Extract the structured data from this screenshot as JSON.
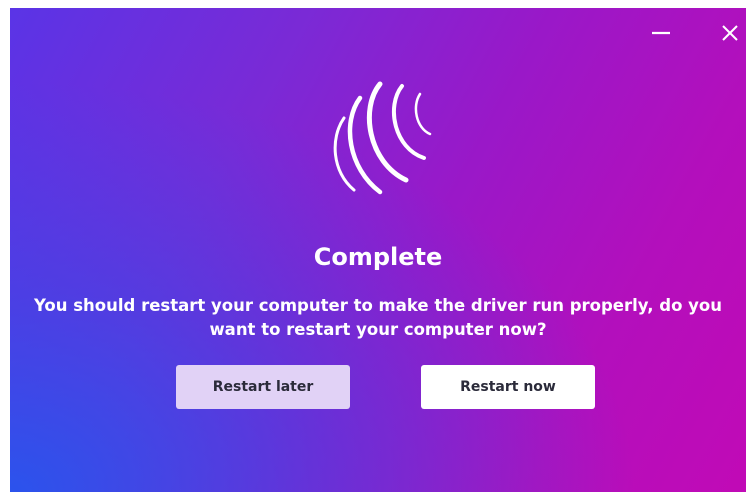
{
  "dialog": {
    "title": "Complete",
    "message_line1": "You should restart your computer to make the driver run properly, do you",
    "message_line2": "want to restart your computer now?",
    "logo_icon": "swirl-sphere-logo-icon"
  },
  "window_controls": {
    "minimize_icon": "minimize-icon",
    "close_icon": "close-icon"
  },
  "buttons": {
    "restart_later": "Restart later",
    "restart_now": "Restart now"
  },
  "colors": {
    "gradient_start": "#2a5cf0",
    "gradient_mid": "#8a22d0",
    "gradient_end": "#c10ab6",
    "secondary_button": "#e1d2f6",
    "primary_button": "#ffffff"
  }
}
